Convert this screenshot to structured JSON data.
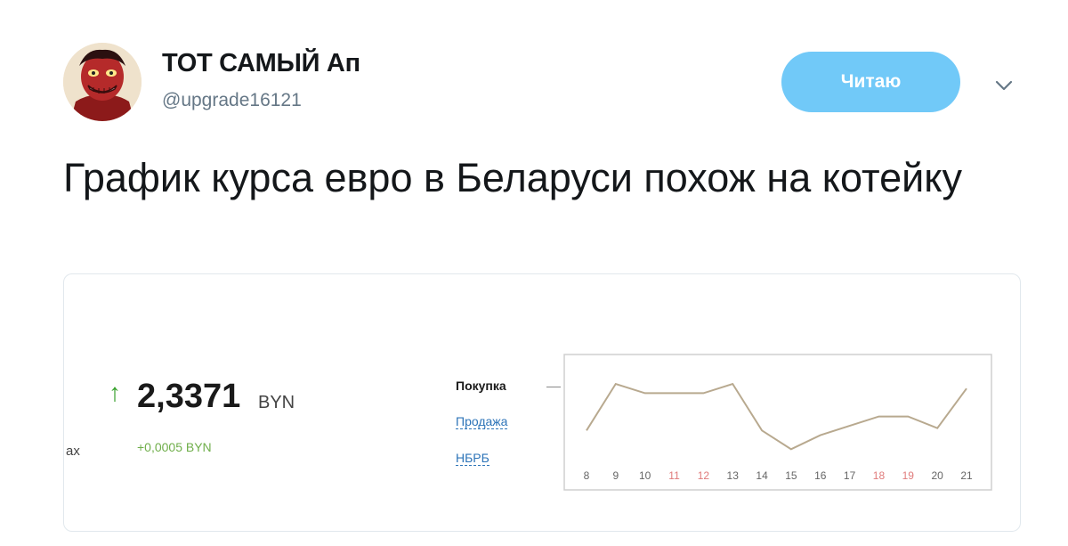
{
  "tweet": {
    "display_name": "ТОТ САМЫЙ Ап",
    "handle": "@upgrade16121",
    "follow_label": "Читаю",
    "text": "График курса евро в Беларуси похож на котейку"
  },
  "card": {
    "rate_value": "2,3371",
    "rate_unit": "BYN",
    "change": "+0,0005 BYN",
    "left_cut_text": "ax",
    "legend": {
      "buy": "Покупка",
      "sell": "Продажа",
      "nbrb": "НБРБ"
    }
  },
  "chart_data": {
    "type": "line",
    "title": "",
    "xlabel": "",
    "ylabel": "",
    "categories": [
      "8",
      "9",
      "10",
      "11",
      "12",
      "13",
      "14",
      "15",
      "16",
      "17",
      "18",
      "19",
      "20",
      "21"
    ],
    "weekend_categories": [
      "11",
      "12",
      "18",
      "19"
    ],
    "series": [
      {
        "name": "Покупка",
        "values": [
          2.328,
          2.338,
          2.336,
          2.336,
          2.336,
          2.338,
          2.328,
          2.324,
          2.327,
          2.329,
          2.331,
          2.331,
          2.3285,
          2.337
        ]
      }
    ],
    "ylim": [
      2.321,
      2.342
    ],
    "grid": false,
    "legend": "left",
    "colors": {
      "line": "#b8a98f",
      "tick": "#666666",
      "tick_weekend": "#e07c7c",
      "frame": "#cfcfcf"
    }
  }
}
